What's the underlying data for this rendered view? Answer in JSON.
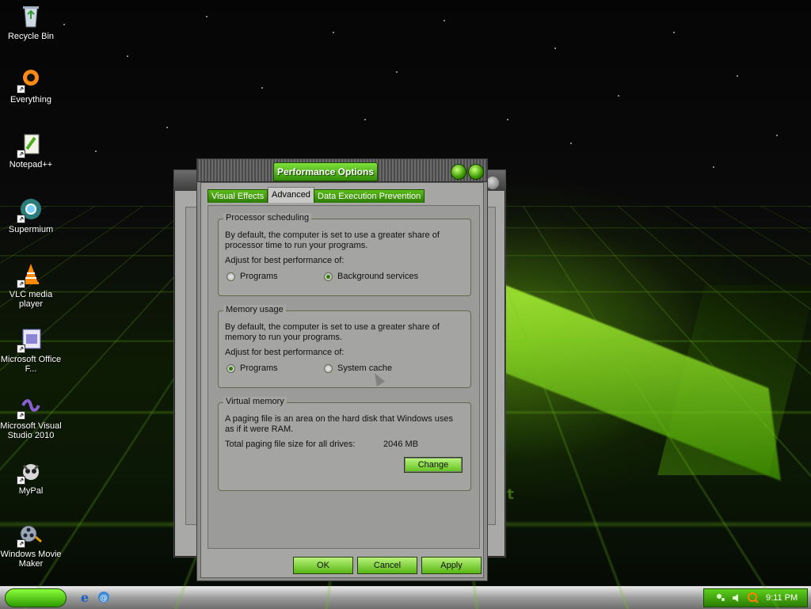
{
  "desktop": {
    "icons": [
      {
        "label": "Recycle Bin",
        "icon": "recycle-bin-icon"
      },
      {
        "label": "Everything",
        "icon": "everything-icon"
      },
      {
        "label": "Notepad++",
        "icon": "notepad-plus-plus-icon"
      },
      {
        "label": "Supermium",
        "icon": "supermium-icon"
      },
      {
        "label": "VLC media player",
        "icon": "vlc-icon"
      },
      {
        "label": "Microsoft Office F...",
        "icon": "office-icon"
      },
      {
        "label": "Microsoft Visual Studio 2010",
        "icon": "visual-studio-icon"
      },
      {
        "label": "MyPal",
        "icon": "mypal-icon"
      },
      {
        "label": "Windows Movie Maker",
        "icon": "movie-maker-icon"
      }
    ]
  },
  "dialog": {
    "title": "Performance Options",
    "tabs": [
      "Visual Effects",
      "Advanced",
      "Data Execution Prevention"
    ],
    "active_tab": "Advanced",
    "processor": {
      "legend": "Processor scheduling",
      "description": "By default, the computer is set to use a greater share of processor time to run your programs.",
      "adjust": "Adjust for best performance of:",
      "options": [
        "Programs",
        "Background services"
      ],
      "selected": "Background services"
    },
    "memory": {
      "legend": "Memory usage",
      "description": "By default, the computer is set to use a greater share of memory to run your programs.",
      "adjust": "Adjust for best performance of:",
      "options": [
        "Programs",
        "System cache"
      ],
      "selected": "Programs"
    },
    "virtual_memory": {
      "legend": "Virtual memory",
      "description": "A paging file is an area on the hard disk that Windows uses as if it were RAM.",
      "total_label": "Total paging file size for all drives:",
      "total_value": "2046 MB",
      "change_label": "Change"
    },
    "buttons": {
      "ok": "OK",
      "cancel": "Cancel",
      "apply": "Apply"
    }
  },
  "taskbar": {
    "clock": "9:11 PM",
    "quicklaunch": [
      "ie-icon",
      "email-icon"
    ]
  },
  "wallpaper": {
    "fragment_text": "et"
  },
  "colors": {
    "accent": "#4fb311",
    "dark_accent": "#2a6e04"
  }
}
